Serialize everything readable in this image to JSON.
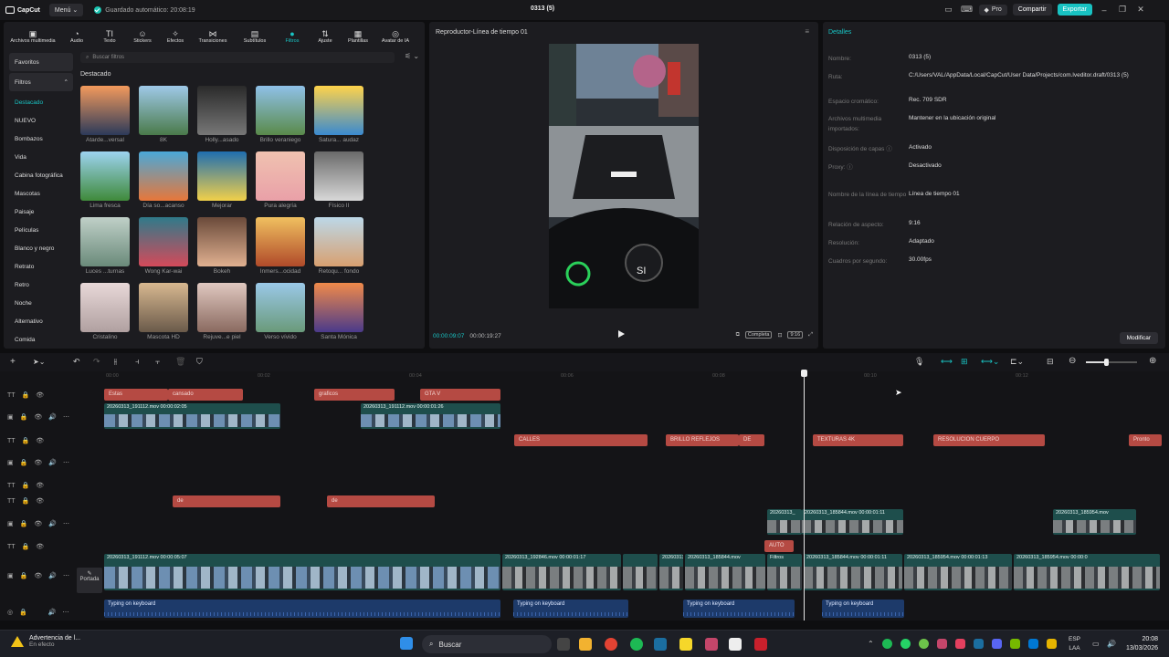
{
  "app": {
    "name": "CapCut",
    "menu_label": "Menú",
    "autosave": "Guardado automático: 20:08:19",
    "project_title": "0313 (5)",
    "pro_label": "Pro",
    "share_label": "Compartir",
    "export_label": "Exportar"
  },
  "toolbar": [
    "Archivos multimedia",
    "Audio",
    "Texto",
    "Stickers",
    "Efectos",
    "Transiciones",
    "Subtítulos",
    "Filtros",
    "Ajuste",
    "Plantillas",
    "Avatar de IA"
  ],
  "sidebar": [
    "Favoritos",
    "Filtros",
    "Destacado",
    "NUEVO",
    "Bombazos",
    "Vida",
    "Cabina fotográfica",
    "Mascotas",
    "Paisaje",
    "Películas",
    "Blanco y negro",
    "Retrato",
    "Retro",
    "Noche",
    "Alternativo",
    "Comida"
  ],
  "search_placeholder": "Buscar filtros",
  "featured_label": "Destacado",
  "filters": [
    "Atarde...versal",
    "8K",
    "Holly...asado",
    "Brillo veraniego",
    "Satura... audaz",
    "Lima fresca",
    "Día so...acanso",
    "Mejorar",
    "Pura alegría",
    "Físico II",
    "Luces ...turnas",
    "Wong Kar-wai",
    "Bokeh",
    "Inmers...ocidad",
    "Retoqu... fondo",
    "Cristalino",
    "Mascota HD",
    "Rejuve...e piel",
    "Verso vívido",
    "Santa Mónica"
  ],
  "player": {
    "title": "Reproductor-Línea de tiempo 01",
    "current": "00:00:09:07",
    "total": "00:00:19:27",
    "full_label": "Completa",
    "ratio": "9:16",
    "overlay_text": "SI"
  },
  "details": {
    "title": "Detalles",
    "rows": [
      {
        "label": "Nombre:",
        "value": "0313 (5)"
      },
      {
        "label": "Ruta:",
        "value": "C:/Users/VAL/AppData/Local/CapCut/User Data/Projects/com.lveditor.draft/0313 (5)"
      },
      {
        "label": "Espacio cromático:",
        "value": "Rec. 709 SDR"
      },
      {
        "label": "Archivos multimedia importados:",
        "value": "Mantener en la ubicación original"
      },
      {
        "label": "Disposición de capas",
        "value": "Activado"
      },
      {
        "label": "Proxy:",
        "value": "Desactivado"
      },
      {
        "label": "Nombre de la línea de tiempo",
        "value": "Línea de tiempo 01"
      },
      {
        "label": "Relación de aspecto:",
        "value": "9:16"
      },
      {
        "label": "Resolución:",
        "value": "Adaptado"
      },
      {
        "label": "Cuadros por segundo:",
        "value": "30.00fps"
      }
    ],
    "modify_label": "Modificar"
  },
  "ruler": [
    "00:00",
    "00:02",
    "00:04",
    "00:06",
    "00:08",
    "00:10",
    "00:12"
  ],
  "cover_label": "Portada",
  "text_clips": [
    "Estas",
    "cansado",
    "graficos",
    "GTA V",
    "CALLES",
    "BRILLO REFLEJOS",
    "DE",
    "TEXTURAS 4K",
    "RESOLUCION CUERPO",
    "Pronto",
    "de",
    "de",
    "AUTO"
  ],
  "video_clips": {
    "a": "20260313_191112.mov  00:00:02:05",
    "b": "20260313_191112.mov  00:00:01:26",
    "c": "20260313_185844.mov  00:00:01:11",
    "c2": "20260313_",
    "d": "20260313_185954.mov",
    "m1": "20260313_191112.mov  00:00:05:07",
    "m2": "20260313_192846.mov  00:00:01:17",
    "m3": "20260313_185844.mov",
    "m4": "Filtros",
    "m5": "20260313_185844.mov  00:00:01:11",
    "m6": "20260313_185954.mov  00:00:01:13",
    "m7": "20260313_185954.mov  00:00:0",
    "m8": "20260313"
  },
  "audio_label": "Typing on keyboard",
  "taskbar": {
    "warning_title": "Advertencia de l...",
    "warning_sub": "En efecto",
    "search": "Buscar",
    "lang1": "ESP",
    "lang2": "LAA",
    "time": "20:08",
    "date": "13/03/2026"
  }
}
